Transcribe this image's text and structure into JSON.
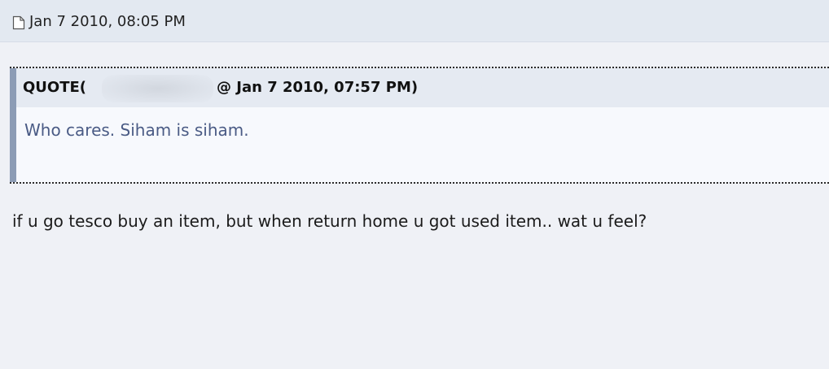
{
  "post": {
    "date": "Jan 7 2010, 08:05 PM",
    "icon": "document-icon",
    "quote": {
      "label": "QUOTE(",
      "meta": "@ Jan 7 2010, 07:57 PM)",
      "text": "Who cares. Siham is siham."
    },
    "message": "if u go tesco buy an item, but when return home u got used item.. wat u feel?"
  },
  "colors": {
    "page_background": "#eff1f6",
    "header_background": "#e3e9f1",
    "quote_accent": "#8c9cb5",
    "quote_title_background": "#e5eaf2",
    "quote_body_background": "#f7f9fd",
    "quote_text": "#4a5b85"
  }
}
